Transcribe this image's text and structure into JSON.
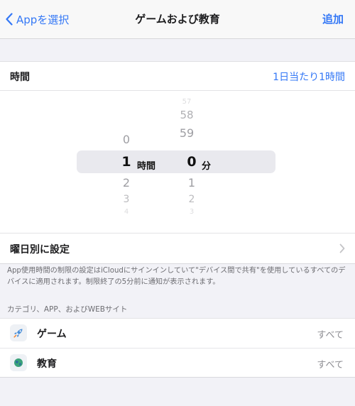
{
  "nav": {
    "back_label": "Appを選択",
    "title": "ゲームおよび教育",
    "action_label": "追加"
  },
  "time": {
    "label": "時間",
    "value": "1日当たり1時間"
  },
  "picker": {
    "hours": {
      "above": [
        "0"
      ],
      "selected": "1",
      "below": [
        "2",
        "3",
        "4"
      ],
      "unit": "時間"
    },
    "minutes": {
      "above": [
        "57",
        "58",
        "59"
      ],
      "selected": "0",
      "below": [
        "1",
        "2",
        "3"
      ],
      "unit": "分"
    }
  },
  "weekday": {
    "label": "曜日別に設定"
  },
  "footnote": "App使用時間の制限の設定はiCloudにサインインしていて\"デバイス間で共有\"を使用しているすべてのデバイスに適用されます。制限終了の5分前に通知が表示されます。",
  "categories": {
    "header": "カテゴリ、APP、およびWEBサイト",
    "items": [
      {
        "label": "ゲーム",
        "value": "すべて",
        "icon": "rocket-icon"
      },
      {
        "label": "教育",
        "value": "すべて",
        "icon": "globe-icon"
      }
    ]
  },
  "colors": {
    "accent": "#3478f6",
    "background": "#f2f2f7"
  }
}
